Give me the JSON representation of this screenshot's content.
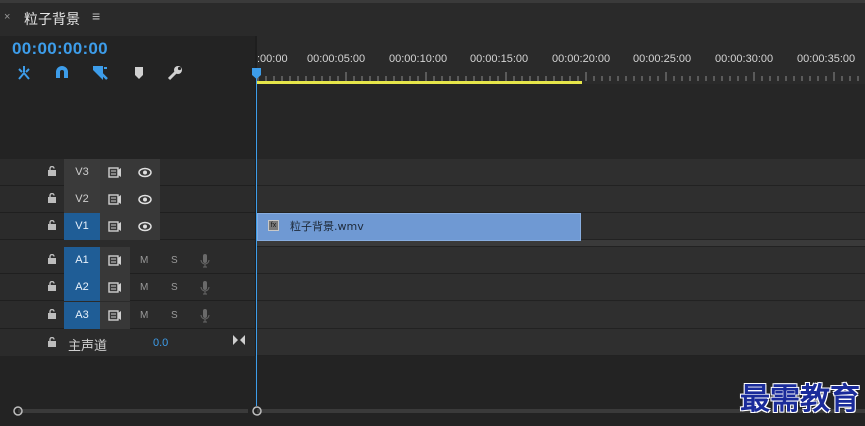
{
  "tab": {
    "close": "×",
    "title": "粒子背景",
    "menu": "≡"
  },
  "timecode": "00:00:00:00",
  "tools": [
    "snap-icon",
    "linked-selection-icon",
    "add-marker-icon",
    "marker-icon",
    "wrench-icon"
  ],
  "ruler": {
    "labels": [
      ":00:00",
      "00:00:05:00",
      "00:00:10:00",
      "00:00:15:00",
      "00:00:20:00",
      "00:00:25:00",
      "00:00:30:00",
      "00:00:35:00"
    ]
  },
  "video_tracks": [
    {
      "name": "V3",
      "active": false
    },
    {
      "name": "V2",
      "active": false
    },
    {
      "name": "V1",
      "active": true
    }
  ],
  "audio_tracks": [
    {
      "name": "A1",
      "active": true,
      "m": "M",
      "s": "S"
    },
    {
      "name": "A2",
      "active": true,
      "m": "M",
      "s": "S"
    },
    {
      "name": "A3",
      "active": true,
      "m": "M",
      "s": "S"
    }
  ],
  "master": {
    "label": "主声道",
    "value": "0.0"
  },
  "clip": {
    "name": "粒子背景.wmv",
    "fx": "fx"
  },
  "watermark": "最需教育",
  "colors": {
    "accent": "#3d9dea",
    "clip": "#6f99d3",
    "workarea": "#e6e64a",
    "watermark": "#1a2b9a"
  }
}
